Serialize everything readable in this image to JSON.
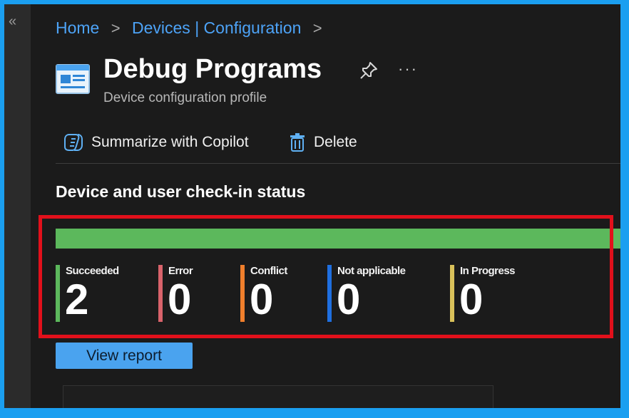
{
  "breadcrumb": {
    "items": [
      "Home",
      "Devices | Configuration"
    ]
  },
  "header": {
    "title": "Debug Programs",
    "subtitle": "Device configuration profile",
    "more_label": "···"
  },
  "toolbar": {
    "copilot_label": "Summarize with Copilot",
    "delete_label": "Delete"
  },
  "checkin": {
    "section_title": "Device and user check-in status",
    "progress_fraction": 1.0,
    "stats": [
      {
        "label": "Succeeded",
        "value": "2",
        "color": "#5cb85c"
      },
      {
        "label": "Error",
        "value": "0",
        "color": "#d9636b"
      },
      {
        "label": "Conflict",
        "value": "0",
        "color": "#f07f2c"
      },
      {
        "label": "Not applicable",
        "value": "0",
        "color": "#1f6fe0"
      },
      {
        "label": "In Progress",
        "value": "0",
        "color": "#d9c15a"
      }
    ],
    "view_report_label": "View report"
  },
  "colors": {
    "accent_link": "#4da3f7",
    "success": "#5cb85c",
    "highlight_border": "#e2101b"
  }
}
